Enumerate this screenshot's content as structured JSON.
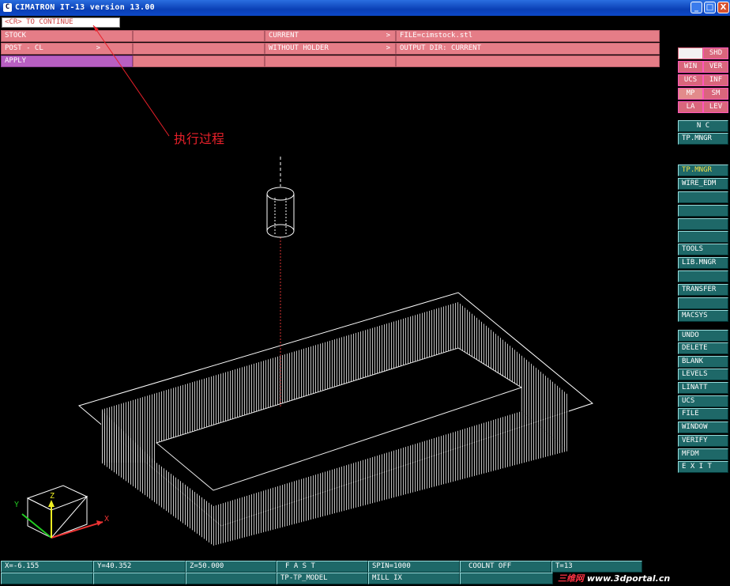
{
  "window": {
    "title": "CIMATRON IT-13 version 13.00",
    "controls": {
      "minimize": "_",
      "maximize": "□",
      "close": "X"
    }
  },
  "prompt": {
    "text": "<CR> TO CONTINUE"
  },
  "menu": {
    "row1": [
      "STOCK",
      "",
      "CURRENT",
      "FILE=cimstock.stl"
    ],
    "row1_arrows": [
      "",
      "",
      ">",
      ""
    ],
    "row2": [
      "POST - CL",
      "",
      "WITHOUT HOLDER",
      "OUTPUT DIR: CURRENT"
    ],
    "row2_arrows": [
      ">",
      "",
      ">",
      ""
    ],
    "row3": [
      "APPLY",
      "",
      "",
      ""
    ]
  },
  "annotation": {
    "text": "执行过程",
    "color": "#e8202a"
  },
  "right_panel": {
    "toggles": [
      {
        "left": "",
        "right": "SHD"
      },
      {
        "left": "WIN",
        "right": "VER"
      },
      {
        "left": "UCS",
        "right": "INF"
      },
      {
        "left": "MP",
        "right": "SM"
      },
      {
        "left": "LA",
        "right": "LEV"
      }
    ],
    "group1": [
      "N C",
      "TP.MNGR"
    ],
    "group2": [
      "TP.MNGR",
      "WIRE_EDM",
      "",
      "",
      "",
      "",
      "TOOLS",
      "LIB.MNGR",
      "",
      "TRANSFER",
      "",
      "MACSYS"
    ],
    "group3": [
      "UNDO",
      "DELETE",
      "BLANK",
      "LEVELS",
      "LINATT",
      "UCS",
      "FILE",
      "WINDOW",
      "VERIFY",
      "MFDM",
      "E X I T"
    ]
  },
  "axis": {
    "x": "X",
    "y": "Y",
    "z": "Z"
  },
  "status": {
    "x": "X=-6.155",
    "y": "Y=40.352",
    "z": "Z=50.000",
    "mode": "F A S T",
    "spin": "SPIN=1000",
    "coolant": "COOLNT OFF",
    "tool": "T=13",
    "model": "TP-TP_MODEL",
    "mill": "MILL IX"
  },
  "watermark": {
    "cn": "三维网",
    "url": "www.3dportal.cn"
  },
  "colors": {
    "menu": "#e57d87",
    "apply": "#b85fc2",
    "panel": "#1e6868",
    "annotation": "#e8202a"
  }
}
